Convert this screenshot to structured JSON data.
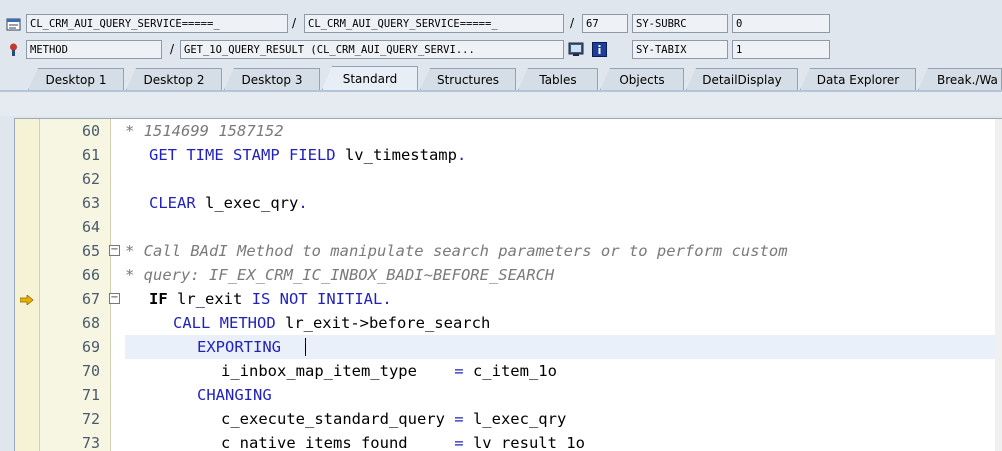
{
  "header": {
    "row1": {
      "field_a": "CL_CRM_AUI_QUERY_SERVICE=====_",
      "field_b": "CL_CRM_AUI_QUERY_SERVICE=====_",
      "line_no": "67",
      "sysvar_name": "SY-SUBRC",
      "sysvar_value": "0"
    },
    "row2": {
      "type": "METHOD",
      "method_name": "GET_1O_QUERY_RESULT (CL_CRM_AUI_QUERY_SERVI...",
      "sysvar_name": "SY-TABIX",
      "sysvar_value": "1"
    },
    "slash": "/"
  },
  "tabs": [
    "Desktop 1",
    "Desktop 2",
    "Desktop 3",
    "Standard",
    "Structures",
    "Tables",
    "Objects",
    "DetailDisplay",
    "Data Explorer",
    "Break./Wa"
  ],
  "active_tab": "Standard",
  "code_lines": [
    {
      "no": "60",
      "text": "* 1514699 1587152"
    },
    {
      "no": "61",
      "text": "GET TIME STAMP FIELD lv_timestamp."
    },
    {
      "no": "62",
      "text": ""
    },
    {
      "no": "63",
      "text": "CLEAR l_exec_qry."
    },
    {
      "no": "64",
      "text": ""
    },
    {
      "no": "65",
      "text": "* Call BAdI Method to manipulate search parameters or to perform custom"
    },
    {
      "no": "66",
      "text": "* query: IF_EX_CRM_IC_INBOX_BADI~BEFORE_SEARCH"
    },
    {
      "no": "67",
      "text": "IF lr_exit IS NOT INITIAL."
    },
    {
      "no": "68",
      "text": "CALL METHOD lr_exit->before_search"
    },
    {
      "no": "69",
      "text": "EXPORTING"
    },
    {
      "no": "70",
      "text": "i_inbox_map_item_type    = c_item_1o"
    },
    {
      "no": "71",
      "text": "CHANGING"
    },
    {
      "no": "72",
      "text": "c_execute_standard_query = l_exec_qry"
    },
    {
      "no": "73",
      "text": "c_native_items_found     = lv_result_1o"
    }
  ],
  "icons": {
    "row1": "program-icon",
    "row2": "method-icon",
    "debug_icon": "display-icon",
    "info_icon": "info-icon",
    "current_line": "arrow-right-icon",
    "fold": "collapse-icon"
  },
  "colors": {
    "keyword": "#2222bb",
    "comment": "#7a7a7a",
    "gutter": "#f6f2d6",
    "arrow": "#e8b000"
  }
}
